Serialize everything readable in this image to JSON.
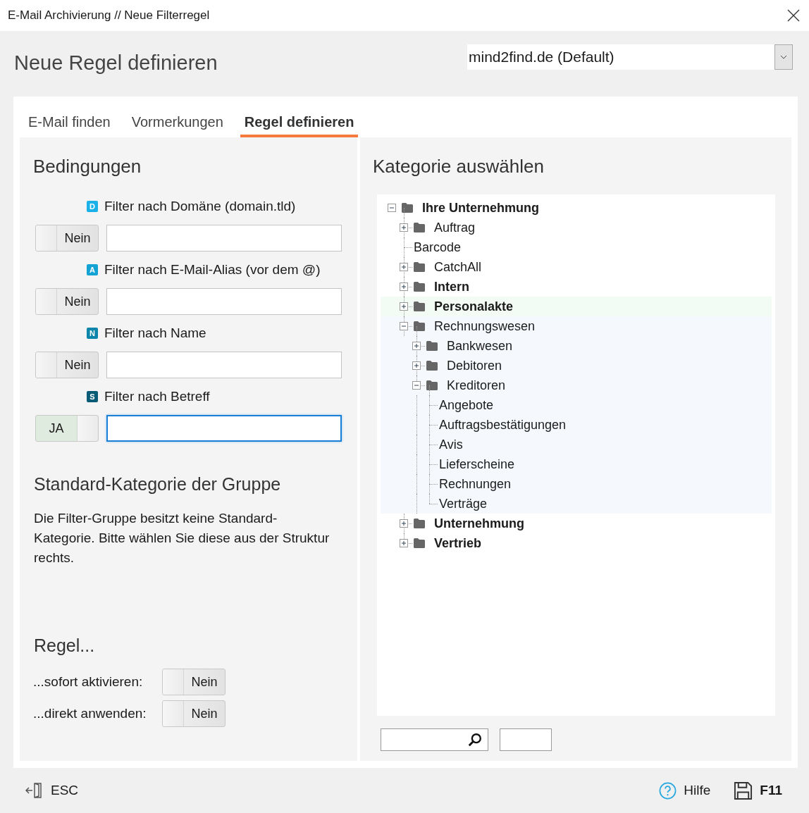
{
  "window": {
    "title": "E-Mail Archivierung // Neue Filterregel"
  },
  "heading": "Neue Regel definieren",
  "account_select": {
    "value": "mind2find.de (Default)"
  },
  "tabs": [
    {
      "label": "E-Mail finden",
      "selected": false
    },
    {
      "label": "Vormerkungen",
      "selected": false
    },
    {
      "label": "Regel definieren",
      "selected": true
    }
  ],
  "conditions": {
    "title": "Bedingungen",
    "filters": [
      {
        "badge": "D",
        "color": "#1ab0e8",
        "label": "Filter nach Domäne (domain.tld)",
        "switch": {
          "on": false,
          "label": "Nein"
        },
        "focused": false
      },
      {
        "badge": "A",
        "color": "#12a3d4",
        "label": "Filter nach E-Mail-Alias (vor dem @)",
        "switch": {
          "on": false,
          "label": "Nein"
        },
        "focused": false
      },
      {
        "badge": "N",
        "color": "#0b86aa",
        "label": "Filter nach Name",
        "switch": {
          "on": false,
          "label": "Nein"
        },
        "focused": false
      },
      {
        "badge": "S",
        "color": "#0a5c76",
        "label": "Filter nach Betreff",
        "switch": {
          "on": true,
          "label": "JA"
        },
        "focused": true
      }
    ]
  },
  "default_category": {
    "title": "Standard-Kategorie der Gruppe",
    "text": "Die Filter-Gruppe besitzt keine Standard-Kategorie. Bitte wählen Sie diese aus der Struktur rechts."
  },
  "rule": {
    "title": "Regel...",
    "options": [
      {
        "label": "...sofort aktivieren:",
        "switch": {
          "on": false,
          "label": "Nein"
        }
      },
      {
        "label": "...direkt anwenden:",
        "switch": {
          "on": false,
          "label": "Nein"
        }
      }
    ]
  },
  "category": {
    "title": "Kategorie auswählen",
    "tree": [
      {
        "label": "Ihre Unternehmung",
        "bold": true,
        "folder": true,
        "expanded": true,
        "children": [
          {
            "label": "Auftrag",
            "bold": false,
            "folder": true,
            "expanded": false
          },
          {
            "label": "Barcode",
            "bold": false,
            "folder": false
          },
          {
            "label": "CatchAll",
            "bold": false,
            "folder": true,
            "expanded": false
          },
          {
            "label": "Intern",
            "bold": true,
            "folder": true,
            "expanded": false
          },
          {
            "label": "Personalakte",
            "bold": true,
            "folder": true,
            "expanded": false,
            "color": "#f3fbf5"
          },
          {
            "label": "Rechnungswesen",
            "bold": false,
            "folder": true,
            "expanded": true,
            "color": "#f5f9fd",
            "children": [
              {
                "label": "Bankwesen",
                "bold": false,
                "folder": true,
                "expanded": false
              },
              {
                "label": "Debitoren",
                "bold": false,
                "folder": true,
                "expanded": false
              },
              {
                "label": "Kreditoren",
                "bold": false,
                "folder": true,
                "expanded": true,
                "children": [
                  {
                    "label": "Angebote",
                    "bold": false,
                    "folder": false
                  },
                  {
                    "label": "Auftragsbestätigungen",
                    "bold": false,
                    "folder": false
                  },
                  {
                    "label": "Avis",
                    "bold": false,
                    "folder": false
                  },
                  {
                    "label": "Lieferscheine",
                    "bold": false,
                    "folder": false
                  },
                  {
                    "label": "Rechnungen",
                    "bold": false,
                    "folder": false
                  },
                  {
                    "label": "Verträge",
                    "bold": false,
                    "folder": false
                  }
                ]
              }
            ]
          },
          {
            "label": "Unternehmung",
            "bold": true,
            "folder": true,
            "expanded": false
          },
          {
            "label": "Vertrieb",
            "bold": true,
            "folder": true,
            "expanded": false
          }
        ]
      }
    ]
  },
  "footer": {
    "cancel": "ESC",
    "help": "Hilfe",
    "save": "F11"
  }
}
